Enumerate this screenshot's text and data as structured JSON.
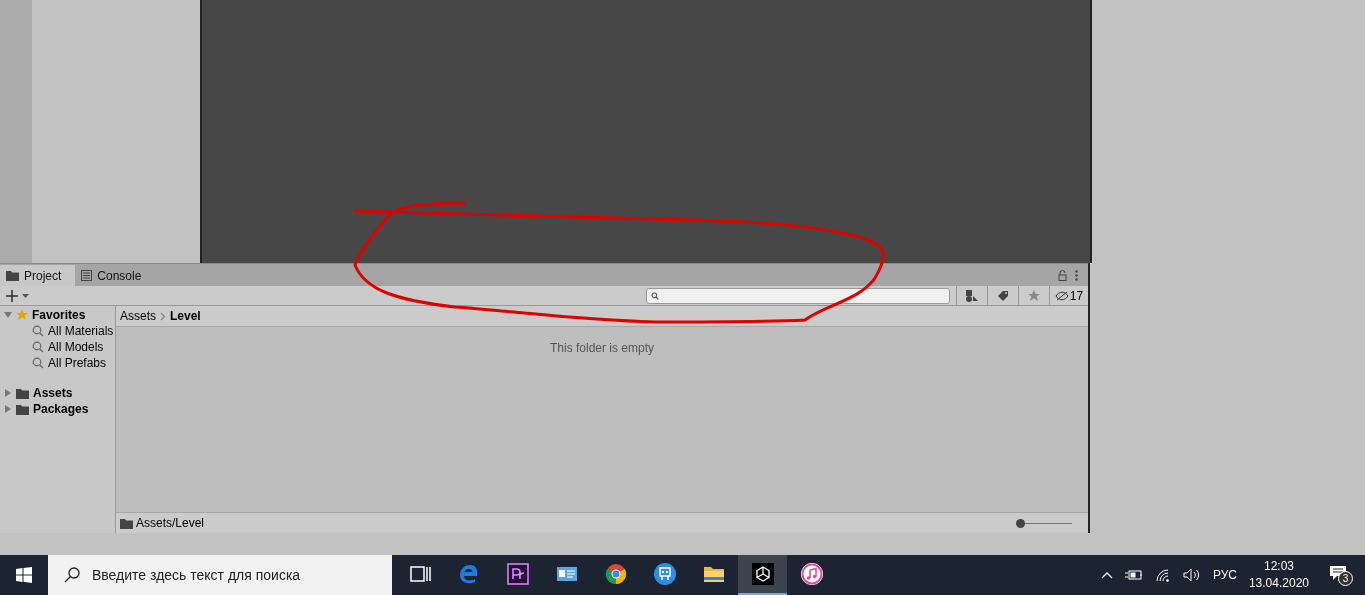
{
  "tabs": [
    {
      "label": "Project",
      "kind": "folder",
      "selected": true
    },
    {
      "label": "Console",
      "kind": "console",
      "selected": false
    }
  ],
  "hidden_count": "17",
  "tree": [
    {
      "label": "Favorites",
      "kind": "star",
      "expanded": true,
      "children": [
        {
          "label": "All Materials"
        },
        {
          "label": "All Models"
        },
        {
          "label": "All Prefabs"
        }
      ]
    },
    {
      "label": "Assets",
      "kind": "folder",
      "expanded": false
    },
    {
      "label": "Packages",
      "kind": "folder",
      "expanded": false
    }
  ],
  "breadcrumb": [
    "Assets",
    "Level"
  ],
  "empty_message": "This folder is empty",
  "footer_path": "Assets/Level",
  "zoom_slider": {
    "level": 0
  },
  "taskbar": {
    "search_placeholder": "Введите здесь текст для поиска",
    "apps": [
      {
        "kind": "taskview",
        "active": false
      },
      {
        "kind": "edge",
        "active": false
      },
      {
        "kind": "premiere",
        "active": false
      },
      {
        "kind": "card",
        "active": false
      },
      {
        "kind": "chrome",
        "active": false
      },
      {
        "kind": "robot",
        "active": false
      },
      {
        "kind": "folder",
        "active": false
      },
      {
        "kind": "unity",
        "active": true
      },
      {
        "kind": "music",
        "active": false
      }
    ],
    "language": "РУС",
    "time": "12:03",
    "date": "13.04.2020",
    "notifications": "3"
  }
}
